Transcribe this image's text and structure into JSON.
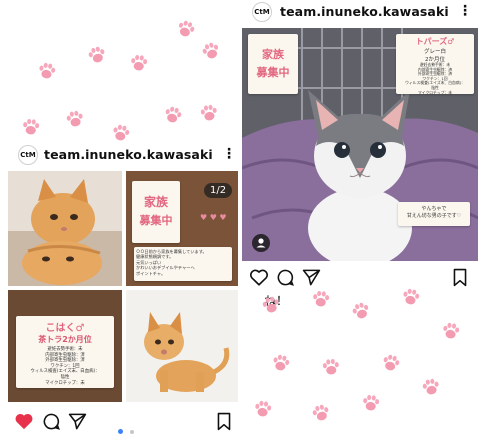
{
  "left_post": {
    "account": {
      "handle": "team.inuneko.kawasaki",
      "avatar_text": "CtM"
    },
    "carousel_counter": "1/2",
    "tiles": {
      "recruit_board": {
        "title_line1": "家族",
        "title_line2": "募集中",
        "notes": [
          "ＯＯ日前から家族を募集しています。",
          "健康状態順調です。",
          "元気いっぱい",
          "かわいいおデブイルやテャーへ",
          "ポイントチャ。"
        ]
      },
      "profile_board": {
        "name": "こはく♂",
        "subtitle": "茶トラ2か月位",
        "details": [
          "避妊去勢手術：未",
          "内部寄生虫駆除：済",
          "外部寄生虫駆除：済",
          "ワクチン：1回",
          "ウィルス検査(エイズ末、白血病)：",
          "陰性",
          "マイクロチップ：未"
        ]
      }
    },
    "actions": {
      "like": "heart-icon-filled",
      "comment": "comment-icon",
      "share": "share-icon",
      "save": "bookmark-icon"
    },
    "colors": {
      "like": "#e8324c",
      "dot_active": "#3b82f6"
    }
  },
  "right_post": {
    "account": {
      "handle": "team.inuneko.kawasaki",
      "avatar_text": "CtM"
    },
    "recruit_sign": {
      "line1": "家族",
      "line2": "募集中"
    },
    "profile_sign": {
      "name": "トパーズ♂",
      "subtitle": "グレー白",
      "age": "2か月位",
      "details": [
        "避妊去勢手術：未",
        "内部寄生虫駆除：済",
        "外部寄生虫駆除：済",
        "ワクチン：1回",
        "ウィルス検査(エイズ末、白血病)：",
        "陰性",
        "マイクロチップ：未"
      ]
    },
    "note_sign": {
      "line1": "やんちゃで",
      "line2": "甘えん坊な男の子です♡"
    },
    "caption": "ね！",
    "actions": {
      "like": "heart-icon",
      "comment": "comment-icon",
      "share": "share-icon",
      "save": "bookmark-icon"
    }
  },
  "colors": {
    "paw_pink": "#f39bb1",
    "paw_toe": "#f6a7bb",
    "board_brown": "#6b4a33",
    "title_pink": "#e2667f"
  }
}
